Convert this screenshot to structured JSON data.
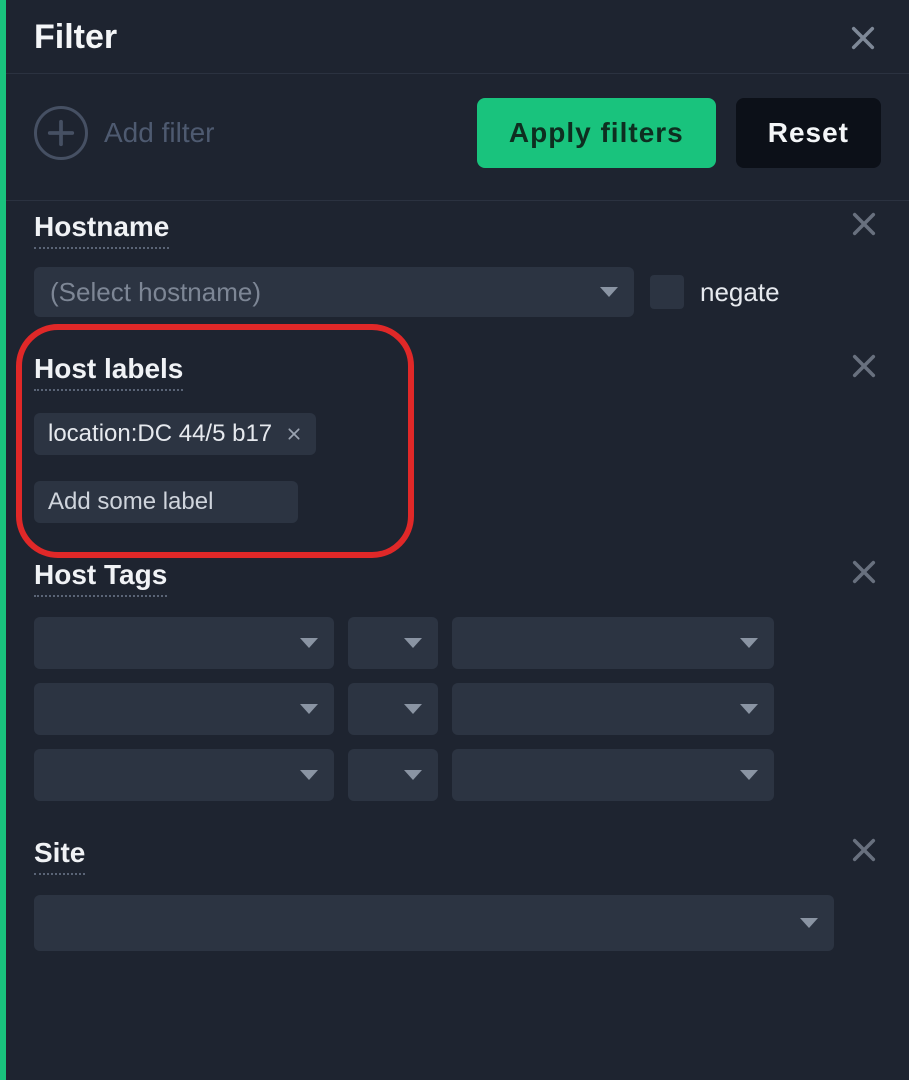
{
  "header": {
    "title": "Filter"
  },
  "actions": {
    "add_filter_label": "Add filter",
    "apply_label": "Apply filters",
    "reset_label": "Reset"
  },
  "sections": {
    "hostname": {
      "title": "Hostname",
      "select_placeholder": "(Select hostname)",
      "negate_label": "negate"
    },
    "host_labels": {
      "title": "Host labels",
      "chips": [
        "location:DC 44/5 b17"
      ],
      "add_placeholder": "Add some label"
    },
    "host_tags": {
      "title": "Host Tags"
    },
    "site": {
      "title": "Site"
    }
  }
}
